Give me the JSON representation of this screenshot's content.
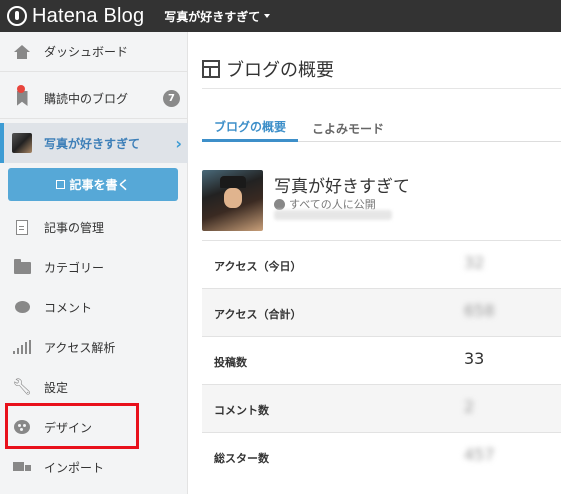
{
  "topbar": {
    "logo_text": "Hatena Blog",
    "blog_switch": "写真が好きすぎて"
  },
  "sidebar": {
    "items": [
      {
        "label": "ダッシュボード",
        "icon": "home-icon"
      },
      {
        "label": "購読中のブログ",
        "icon": "bookmark-icon",
        "badge": "7"
      },
      {
        "label": "写真が好きすぎて",
        "icon": "blog-thumbnail",
        "chevron": "›"
      },
      {
        "label": "記事の管理",
        "icon": "document-icon"
      },
      {
        "label": "カテゴリー",
        "icon": "folder-icon"
      },
      {
        "label": "コメント",
        "icon": "comment-icon"
      },
      {
        "label": "アクセス解析",
        "icon": "bar-chart-icon"
      },
      {
        "label": "設定",
        "icon": "wrench-icon"
      },
      {
        "label": "デザイン",
        "icon": "palette-icon"
      },
      {
        "label": "インポート",
        "icon": "truck-icon"
      }
    ],
    "write_button": "記事を書く"
  },
  "main": {
    "title": "ブログの概要",
    "tabs": [
      {
        "label": "ブログの概要",
        "active": true
      },
      {
        "label": "こよみモード",
        "active": false
      }
    ],
    "blog": {
      "name": "写真が好きすぎて",
      "visibility": "すべての人に公開",
      "url": "http://xxxxx.hatenablog.jp/"
    },
    "stats": [
      {
        "label": "アクセス（今日）",
        "value": "32"
      },
      {
        "label": "アクセス（合計）",
        "value": "658"
      },
      {
        "label": "投稿数",
        "value": "33"
      },
      {
        "label": "コメント数",
        "value": "2"
      },
      {
        "label": "総スター数",
        "value": "457"
      }
    ]
  },
  "colors": {
    "topbar": "#333333",
    "accent": "#3d8fc9",
    "write_button": "#56a8d7",
    "highlight": "#e8101b"
  }
}
